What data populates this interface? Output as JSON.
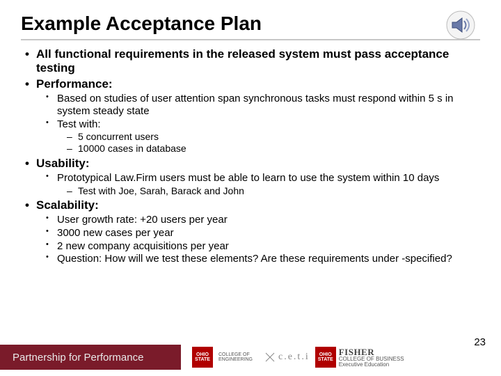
{
  "title": "Example Acceptance Plan",
  "bullets": {
    "b1": "All functional requirements in the released system must pass acceptance testing",
    "b2": "Performance:",
    "b2_1": "Based on studies of user attention span synchronous tasks must respond within 5 s in system steady state",
    "b2_2": "Test with:",
    "b2_2_1": "5 concurrent users",
    "b2_2_2": "10000 cases in database",
    "b3": "Usability:",
    "b3_1": "Prototypical Law.Firm users must be able to learn to use the system within 10 days",
    "b3_1_1": "Test with Joe, Sarah, Barack and John",
    "b4": "Scalability:",
    "b4_1": "User growth rate: +20 users per year",
    "b4_2": "3000 new cases per year",
    "b4_3": "2 new company acquisitions per year",
    "b4_4": "Question: How will we test these elements? Are these requirements under -specified?"
  },
  "footer": {
    "tagline": "Partnership for Performance",
    "page_number": "23",
    "logos": {
      "osu_block": "OHIO STATE",
      "eng_line1": "COLLEGE OF",
      "eng_line2": "ENGINEERING",
      "ceti": "c.e.t.i",
      "fisher_big": "FISHER",
      "fisher_small1": "COLLEGE OF BUSINESS",
      "fisher_small2": "Executive Education"
    }
  }
}
